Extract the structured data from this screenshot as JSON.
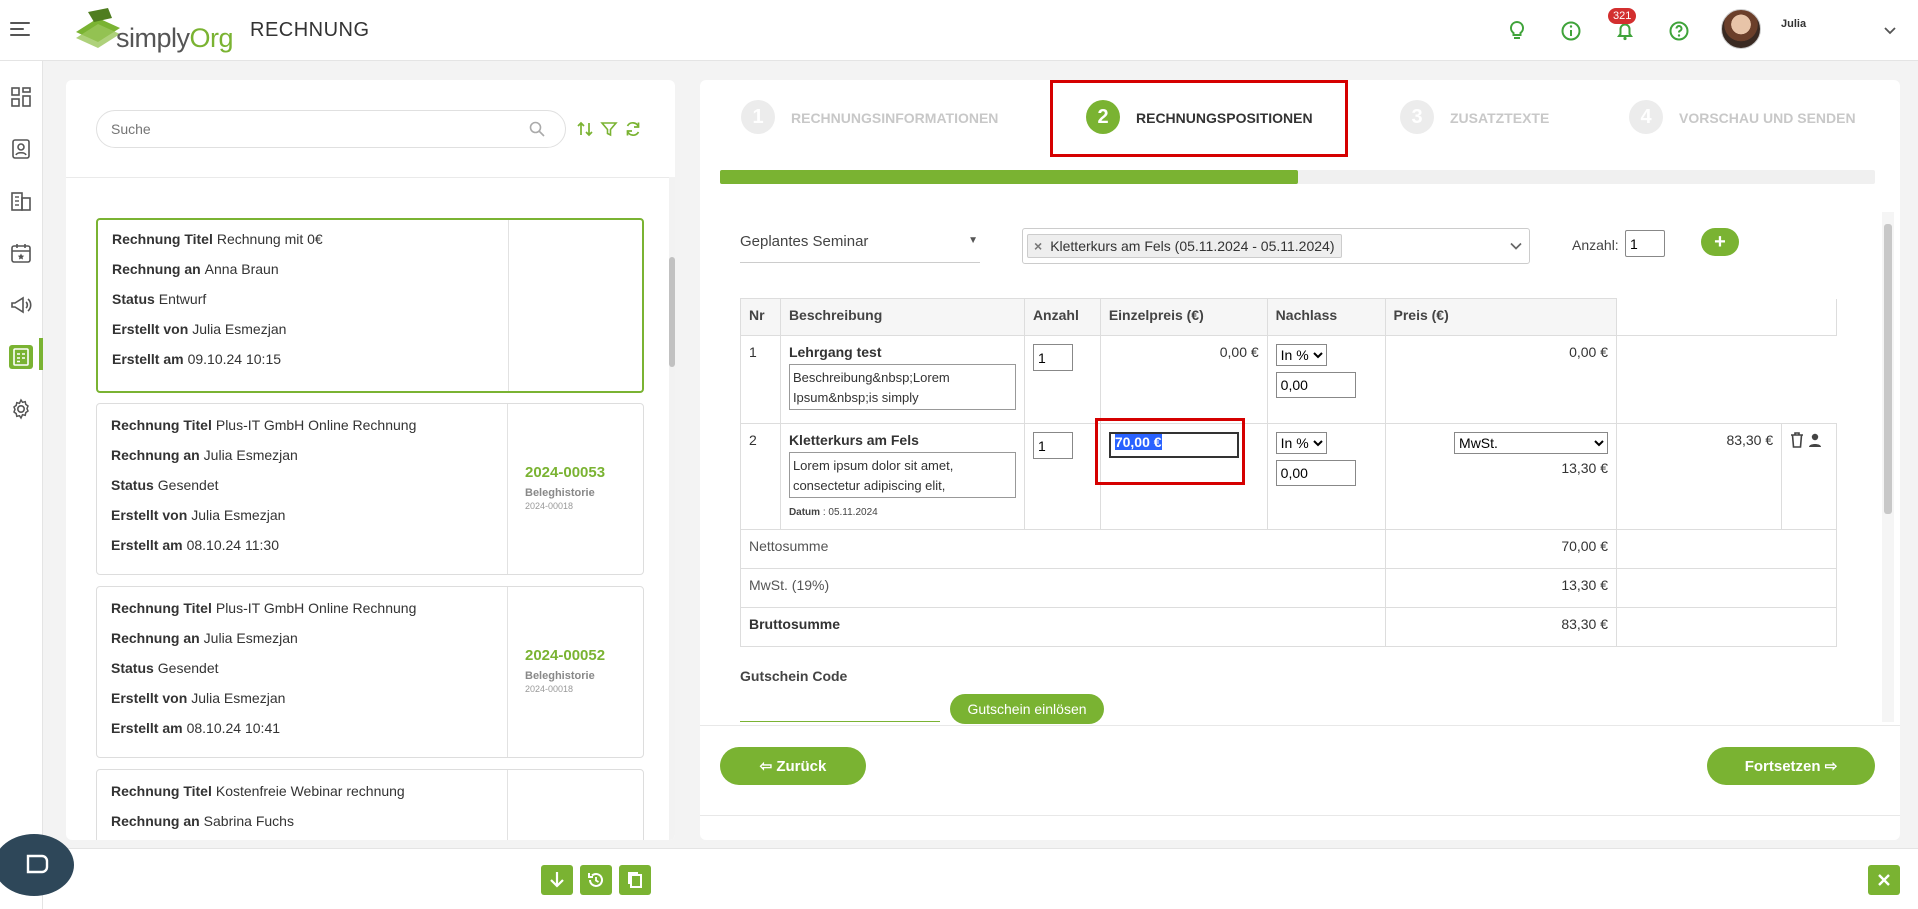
{
  "header": {
    "logo_text_1": "simply",
    "logo_text_2": "Org",
    "page_title": "RECHNUNG",
    "notification_count": "321",
    "user_name": "Julia"
  },
  "sidebar": {
    "items": [
      "dashboard-icon",
      "contacts-icon",
      "buildings-icon",
      "calendar-icon",
      "megaphone-icon",
      "invoice-icon",
      "settings-icon"
    ]
  },
  "list": {
    "search_placeholder": "Suche",
    "labels": {
      "title": "Rechnung Titel",
      "to": "Rechnung an",
      "status": "Status",
      "by": "Erstellt von",
      "at": "Erstellt am",
      "history": "Beleghistorie"
    },
    "cards": [
      {
        "title": "Rechnung mit 0€",
        "to": "Anna Braun",
        "status": "Entwurf",
        "by": "Julia Esmezjan",
        "at": "09.10.24 10:15",
        "number": "",
        "history_no": ""
      },
      {
        "title": "Plus-IT GmbH Online Rechnung",
        "to": "Julia Esmezjan",
        "status": "Gesendet",
        "by": "Julia Esmezjan",
        "at": "08.10.24 11:30",
        "number": "2024-00053",
        "history_no": "2024-00018"
      },
      {
        "title": "Plus-IT GmbH Online Rechnung",
        "to": "Julia Esmezjan",
        "status": "Gesendet",
        "by": "Julia Esmezjan",
        "at": "08.10.24 10:41",
        "number": "2024-00052",
        "history_no": "2024-00018"
      },
      {
        "title": "Kostenfreie Webinar rechnung",
        "to": "Sabrina Fuchs",
        "status": "",
        "by": "",
        "at": "",
        "number": "",
        "history_no": ""
      }
    ]
  },
  "steps": [
    {
      "num": "1",
      "label": "RECHNUNGSINFORMATIONEN"
    },
    {
      "num": "2",
      "label": "RECHNUNGSPOSITIONEN"
    },
    {
      "num": "3",
      "label": "ZUSATZTEXTE"
    },
    {
      "num": "4",
      "label": "VORSCHAU UND SENDEN"
    }
  ],
  "progress_fraction": 0.5,
  "form": {
    "seminar_select": "Geplantes Seminar",
    "chip": "Kletterkurs am Fels (05.11.2024 - 05.11.2024)",
    "anzahl_label": "Anzahl:",
    "anzahl_value": "1",
    "plus": "+"
  },
  "table": {
    "headers": [
      "Nr",
      "Beschreibung",
      "Anzahl",
      "Einzelpreis (€)",
      "Nachlass",
      "Preis (€)"
    ],
    "rows": [
      {
        "nr": "1",
        "title": "Lehrgang test",
        "desc": "Beschreibung&nbsp;Lorem Ipsum&nbsp;is simply",
        "qty": "1",
        "unit": "0,00 €",
        "disc_type": "In %",
        "disc": "0,00",
        "tax": "",
        "tax_amount": "",
        "price": "0,00 €",
        "datum_label": "",
        "datum": ""
      },
      {
        "nr": "2",
        "title": "Kletterkurs am Fels",
        "desc": "Lorem ipsum dolor sit amet, consectetur adipiscing elit,",
        "qty": "1",
        "unit": "70,00 €",
        "disc_type": "In %",
        "disc": "0,00",
        "tax": "MwSt.",
        "tax_amount": "13,30 €",
        "price": "83,30 €",
        "datum_label": "Datum",
        "datum": ": 05.11.2024"
      }
    ],
    "sums": [
      {
        "label": "Nettosumme",
        "value": "70,00 €"
      },
      {
        "label": "MwSt. (19%)",
        "value": "13,30 €"
      },
      {
        "label": "Bruttosumme",
        "value": "83,30 €"
      }
    ]
  },
  "voucher": {
    "label": "Gutschein Code",
    "button": "Gutschein einlösen"
  },
  "nav": {
    "back": "Zurück",
    "next": "Fortsetzen"
  },
  "colors": {
    "accent": "#7ab332",
    "highlight": "#d50000",
    "selection": "#2962ff"
  }
}
